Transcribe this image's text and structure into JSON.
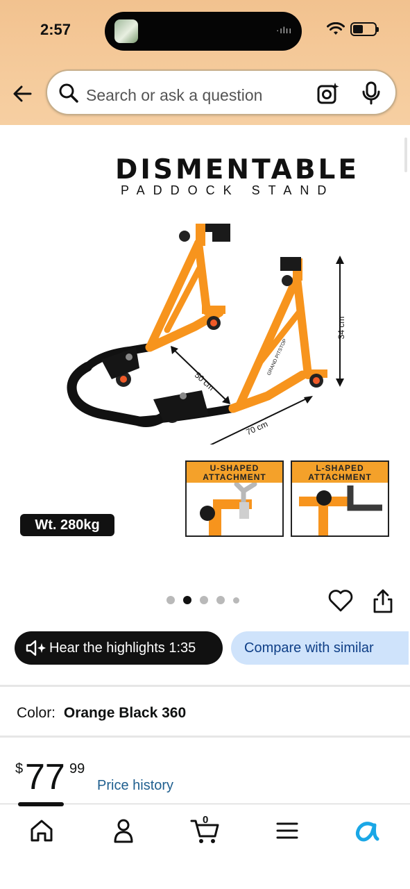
{
  "status_bar": {
    "time": "2:57",
    "signal_text": "·ılıı"
  },
  "search": {
    "placeholder": "Search or ask a question"
  },
  "product_image": {
    "title": "DISMENTABLE",
    "subtitle": "PADDOCK STAND",
    "dim_height": "34 cm",
    "dim_width": "50 cm",
    "dim_length": "70 cm",
    "brand_mark": "GRAND PITSTOP",
    "attachment_u": "U-SHAPED\nATTACHMENT",
    "attachment_l": "L-SHAPED\nATTACHMENT",
    "weight": "Wt. 280kg",
    "accent_color": "#f7941d"
  },
  "carousel": {
    "count": 5,
    "active_index": 1
  },
  "actions": {
    "hear_highlights": "Hear the highlights 1:35",
    "compare": "Compare with similar"
  },
  "color": {
    "label": "Color:",
    "value": "Orange Black 360"
  },
  "price": {
    "currency": "$",
    "whole": "77",
    "fraction": "99",
    "history_link": "Price history"
  },
  "bottom_nav": {
    "items": [
      "home-icon",
      "account-icon",
      "cart-icon",
      "menu-icon",
      "rufus-icon"
    ],
    "cart_count": "0",
    "active_index": 0
  }
}
